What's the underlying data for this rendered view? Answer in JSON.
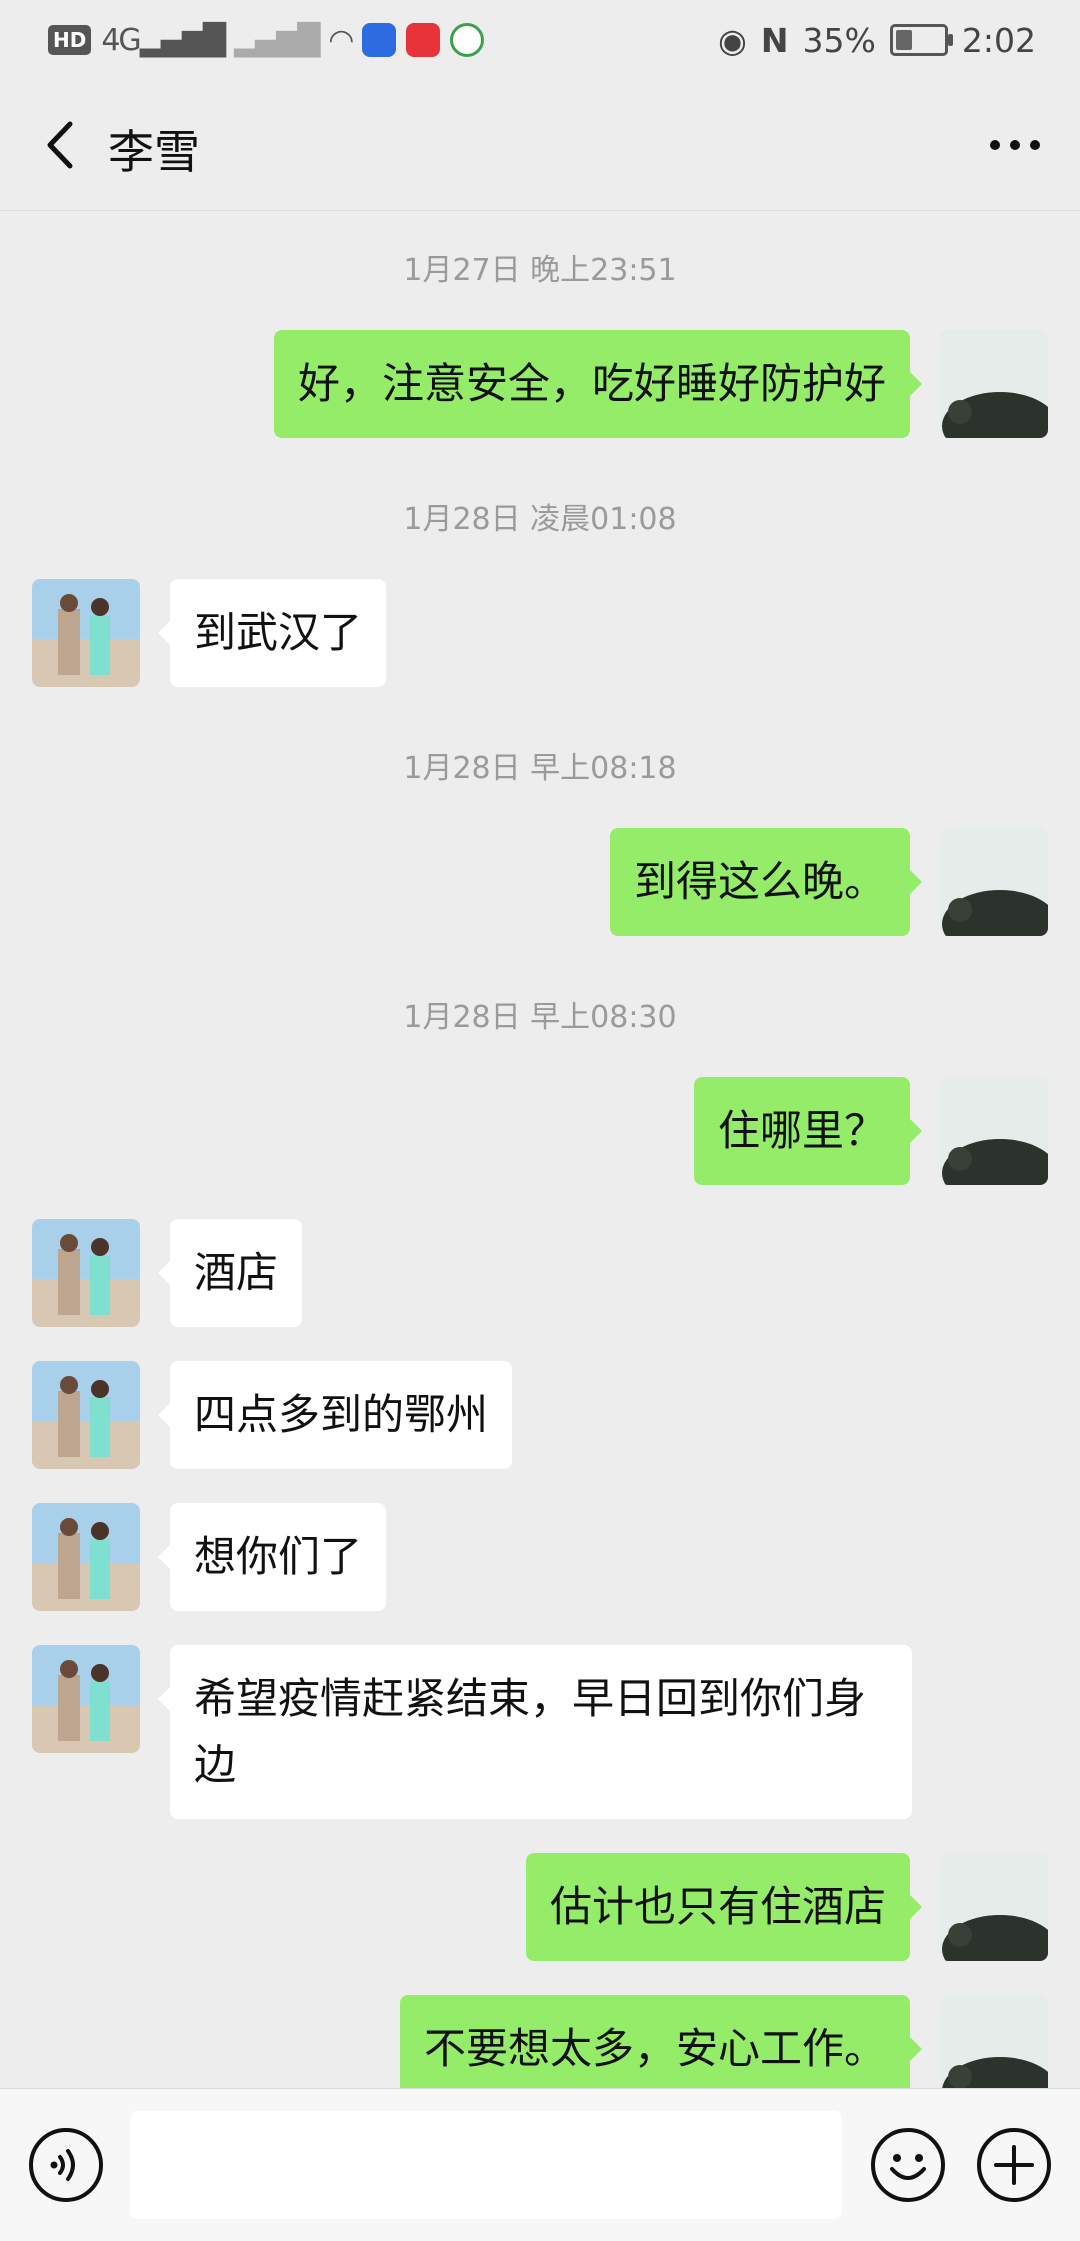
{
  "status_bar": {
    "network": "HD",
    "signal1": "4G",
    "battery": "35%",
    "battery_level": 0.35,
    "time": "2:02"
  },
  "header": {
    "title": "李雪"
  },
  "timestamps": [
    "1月27日 晚上23:51",
    "1月28日 凌晨01:08",
    "1月28日 早上08:18",
    "1月28日 早上08:30"
  ],
  "messages": [
    {
      "side": "out",
      "text": "好，注意安全，吃好睡好防护好"
    },
    {
      "side": "in",
      "text": "到武汉了"
    },
    {
      "side": "out",
      "text": "到得这么晚。"
    },
    {
      "side": "out",
      "text": "住哪里？"
    },
    {
      "side": "in",
      "text": "酒店"
    },
    {
      "side": "in",
      "text": "四点多到的鄂州"
    },
    {
      "side": "in",
      "text": "想你们了"
    },
    {
      "side": "in",
      "text": "希望疫情赶紧结束，早日回到你们身边"
    },
    {
      "side": "out",
      "text": "估计也只有住酒店"
    },
    {
      "side": "out",
      "text": "不要想太多，安心工作。"
    }
  ],
  "input": {
    "value": ""
  },
  "icons": {
    "back": "back-arrow-icon",
    "more": "more-dots-icon",
    "voice": "voice-icon",
    "emoji": "emoji-icon",
    "plus": "plus-icon"
  },
  "colors": {
    "outgoing_bubble": "#95ec69",
    "incoming_bubble": "#ffffff",
    "background": "#ededed"
  }
}
